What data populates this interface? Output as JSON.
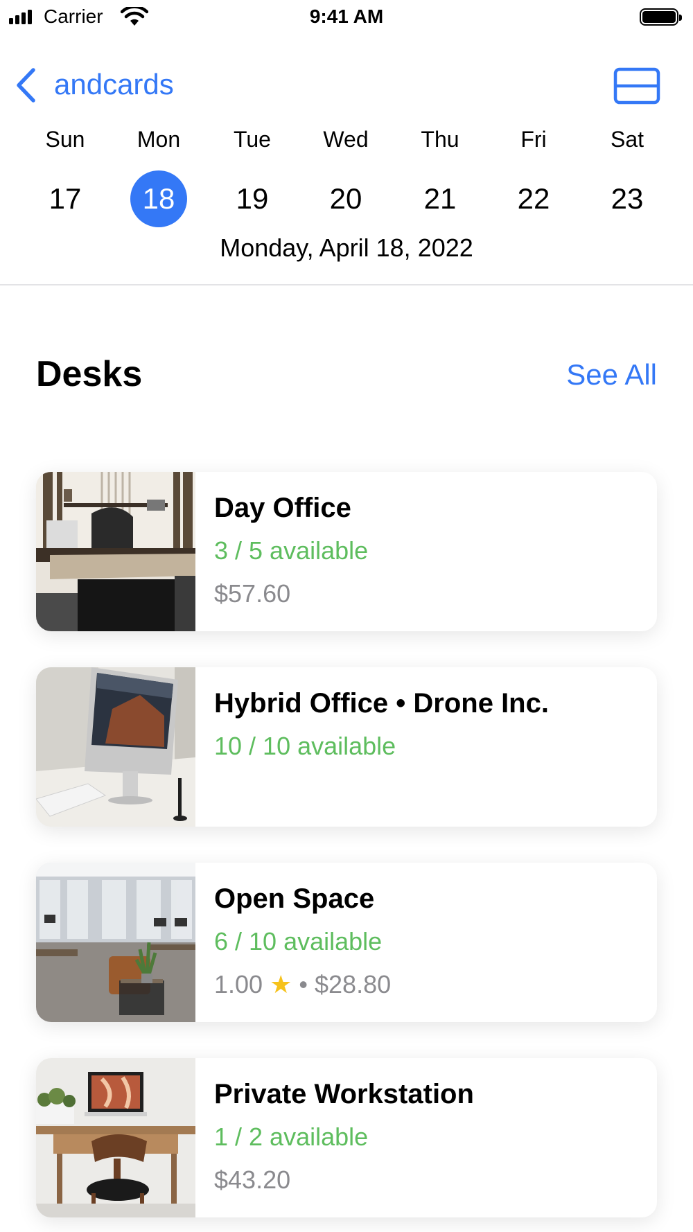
{
  "status_bar": {
    "carrier": "Carrier",
    "time": "9:41 AM"
  },
  "nav": {
    "back_label": "andcards",
    "right_icon": "layout-toggle-icon"
  },
  "calendar": {
    "days": [
      {
        "name": "Sun",
        "number": "17"
      },
      {
        "name": "Mon",
        "number": "18",
        "selected": true
      },
      {
        "name": "Tue",
        "number": "19"
      },
      {
        "name": "Wed",
        "number": "20"
      },
      {
        "name": "Thu",
        "number": "21"
      },
      {
        "name": "Fri",
        "number": "22"
      },
      {
        "name": "Sat",
        "number": "23"
      }
    ],
    "selected_date": "Monday, April 18, 2022"
  },
  "section": {
    "title": "Desks",
    "see_all": "See All"
  },
  "desks": [
    {
      "title": "Day Office",
      "availability": "3 / 5 available",
      "rating": "",
      "price": "$57.60"
    },
    {
      "title": "Hybrid Office • Drone Inc.",
      "availability": "10 / 10 available",
      "rating": "",
      "price": ""
    },
    {
      "title": "Open Space",
      "availability": "6 / 10 available",
      "rating": "1.00",
      "price": "$28.80"
    },
    {
      "title": "Private Workstation",
      "availability": "1 / 2 available",
      "rating": "",
      "price": "$43.20"
    }
  ],
  "colors": {
    "accent": "#3478f6",
    "available": "#5ebd5e",
    "secondary_text": "#8a8a8e"
  }
}
